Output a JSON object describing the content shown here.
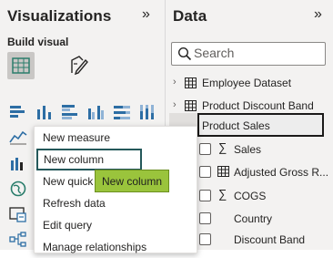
{
  "visualizations": {
    "title": "Visualizations",
    "collapse_glyph": "»",
    "build_visual_label": "Build visual",
    "tiles": [
      {
        "name": "table-build-icon",
        "selected": true
      },
      {
        "name": "format-visual-icon",
        "selected": false
      }
    ],
    "gallery_icons": [
      "stacked-bar-chart-icon",
      "stacked-column-chart-icon",
      "clustered-bar-chart-icon",
      "clustered-column-chart-icon",
      "100-percent-bar-chart-icon",
      "100-percent-column-chart-icon",
      "line-chart-icon",
      "waterfall-chart-icon",
      "globe-map-icon",
      "card-visual-icon",
      "decomposition-tree-icon"
    ]
  },
  "context_menu": {
    "items": [
      {
        "label": "New measure"
      },
      {
        "label": "New column",
        "focused": true
      },
      {
        "label": "New quick"
      },
      {
        "label": "Refresh data"
      },
      {
        "label": "Edit query"
      },
      {
        "label": "Manage relationships"
      }
    ],
    "tooltip": "New column"
  },
  "data": {
    "title": "Data",
    "collapse_glyph": "»",
    "search_placeholder": "Search",
    "tables": [
      {
        "label": "Employee Dataset"
      },
      {
        "label": "Product Discount Band"
      },
      {
        "label": "Product Sales",
        "selected": true
      }
    ],
    "fields": [
      {
        "label": "Sales",
        "type": "sigma",
        "expand": true
      },
      {
        "label": "Adjusted Gross R...",
        "type": "table",
        "expand": false
      },
      {
        "label": "COGS",
        "type": "sigma",
        "expand": true
      },
      {
        "label": "Country",
        "type": "none",
        "expand": false
      },
      {
        "label": "Discount Band",
        "type": "none",
        "expand": false
      }
    ]
  },
  "colors": {
    "pane_bg": "#f3f2f1",
    "accent_focus": "#24585a",
    "tooltip_bg": "#9ac43c",
    "icon_blue": "#2d6ea4"
  }
}
